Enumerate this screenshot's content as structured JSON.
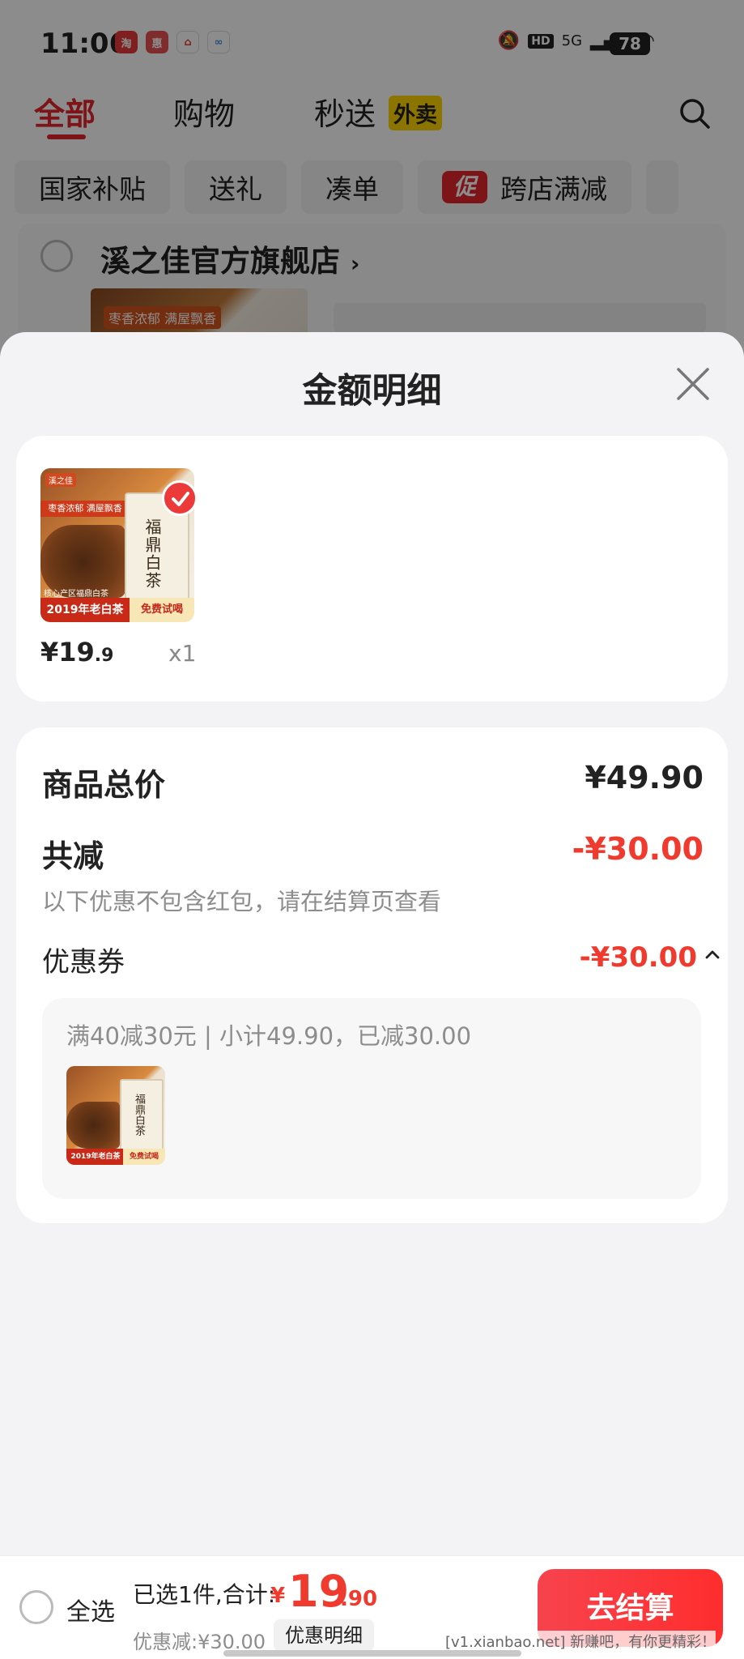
{
  "status_bar": {
    "time": "11:06",
    "apps": [
      {
        "icon": "app-icon-1",
        "label": "淘",
        "color": "#e73a3a"
      },
      {
        "icon": "app-icon-2",
        "label": "惠",
        "color": "#e85050"
      },
      {
        "icon": "app-icon-3",
        "label": "⌂",
        "color": "#e53935"
      },
      {
        "icon": "app-icon-4",
        "label": "∞",
        "color": "#4a90e2"
      }
    ],
    "network": "5G",
    "hd": "HD",
    "battery": "78"
  },
  "top_tabs": {
    "all": "全部",
    "shopping": "购物",
    "flash": "秒送",
    "takeout_tag": "外卖"
  },
  "filter_chips": [
    "国家补贴",
    "送礼",
    "凑单",
    "跨店满减"
  ],
  "promo_mark": "促",
  "shop": {
    "name": "溪之佳官方旗舰店",
    "arrow": "›",
    "thumb_tag": "枣香浓郁 满屋飘香"
  },
  "sheet": {
    "title": "金额明细"
  },
  "item": {
    "image_text": {
      "logo": "溪之佳",
      "top_banner": "枣香浓郁 满屋飘香",
      "bag_text": "福鼎白茶",
      "small": "核心产区福鼎白茶",
      "bottom_red": "2019年老白茶",
      "bottom_tag": "免费试喝"
    },
    "price_symbol": "¥",
    "price_int": "19",
    "price_dec": ".9",
    "qty": "x1"
  },
  "summary": {
    "total_label": "商品总价",
    "total_value": "¥49.90",
    "reduce_label": "共减",
    "reduce_value": "-¥30.00",
    "note": "以下优惠不包含红包，请在结算页查看",
    "coupon_label": "优惠券",
    "coupon_value": "-¥30.00",
    "coupon_desc": "满40减30元 | 小计49.90，已减30.00"
  },
  "bottom_bar": {
    "select_all": "全选",
    "selected_text": "已选1件,合计:",
    "total_symbol": "¥",
    "total_int": "19",
    "total_dec": ".90",
    "discount": "优惠减:¥30.00",
    "detail_button": "优惠明细",
    "checkout_button": "去结算",
    "watermark": "[v1.xianbao.net] 新赚吧，有你更精彩！"
  },
  "colors": {
    "accent_red": "#e4262b",
    "price_red": "#f13a2e",
    "takeout_yellow": "#ffd400"
  }
}
